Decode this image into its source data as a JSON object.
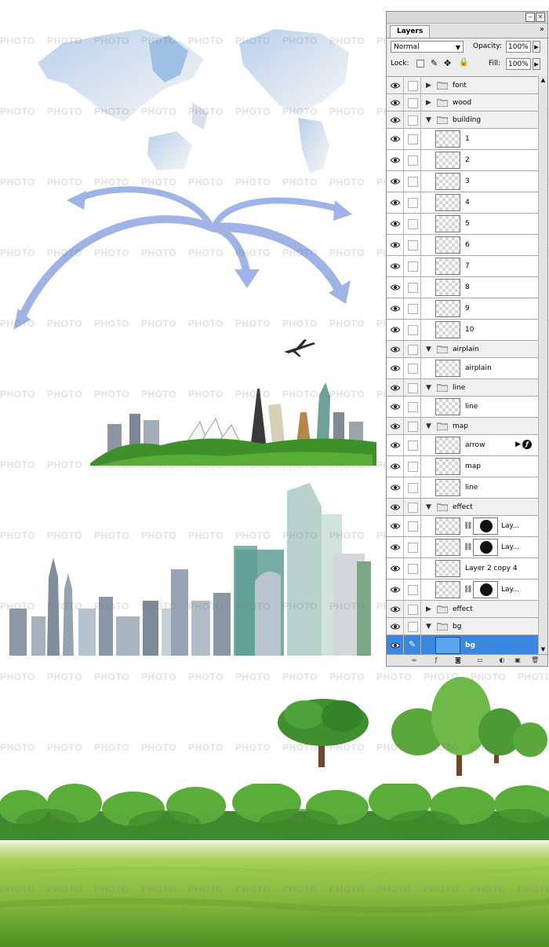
{
  "watermark": {
    "text": "PHOTO"
  },
  "layers_panel": {
    "tab_label": "Layers",
    "menu_glyph": "»",
    "blend_mode": "Normal",
    "opacity_label": "Opacity:",
    "opacity_value": "100%",
    "lock_label": "Lock:",
    "fill_label": "Fill:",
    "fill_value": "100%",
    "rows": [
      {
        "kind": "group",
        "name": "font",
        "open": false
      },
      {
        "kind": "group",
        "name": "wood",
        "open": false
      },
      {
        "kind": "group",
        "name": "building",
        "open": true
      },
      {
        "kind": "layer",
        "name": "1"
      },
      {
        "kind": "layer",
        "name": "2"
      },
      {
        "kind": "layer",
        "name": "3"
      },
      {
        "kind": "layer",
        "name": "4"
      },
      {
        "kind": "layer",
        "name": "5"
      },
      {
        "kind": "layer",
        "name": "6"
      },
      {
        "kind": "layer",
        "name": "7"
      },
      {
        "kind": "layer",
        "name": "8"
      },
      {
        "kind": "layer",
        "name": "9"
      },
      {
        "kind": "layer",
        "name": "10"
      },
      {
        "kind": "group",
        "name": "airplain",
        "open": true
      },
      {
        "kind": "layer",
        "name": "airplain"
      },
      {
        "kind": "group",
        "name": "line",
        "open": true
      },
      {
        "kind": "layer",
        "name": "line"
      },
      {
        "kind": "group",
        "name": "map",
        "open": true
      },
      {
        "kind": "layer",
        "name": "arrow",
        "fx": true
      },
      {
        "kind": "layer",
        "name": "map"
      },
      {
        "kind": "layer",
        "name": "line"
      },
      {
        "kind": "group",
        "name": "effect",
        "open": true
      },
      {
        "kind": "layer",
        "name": "Lay...",
        "mask": true
      },
      {
        "kind": "layer",
        "name": "Lay...",
        "mask": true
      },
      {
        "kind": "layer",
        "name": "Layer 2 copy 4"
      },
      {
        "kind": "layer",
        "name": "Lay...",
        "mask": true
      },
      {
        "kind": "group",
        "name": "effect",
        "open": false
      },
      {
        "kind": "group",
        "name": "bg",
        "open": true
      },
      {
        "kind": "layer",
        "name": "bg",
        "selected": true,
        "blue": true
      }
    ]
  },
  "colors": {
    "arrow": "#9fb3e6",
    "selection": "#3b88e0",
    "grass": "#7fb53a"
  }
}
